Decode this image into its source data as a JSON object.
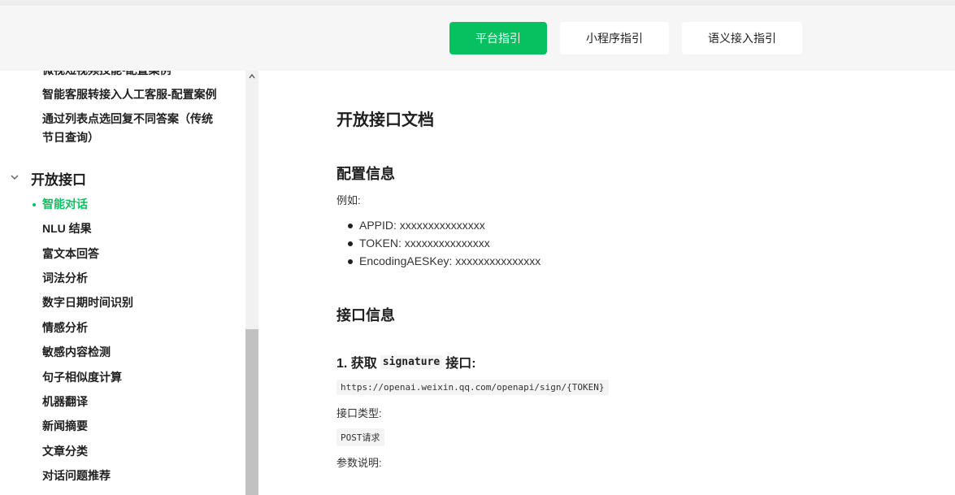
{
  "topnav": {
    "buttons": [
      {
        "label": "平台指引",
        "active": true
      },
      {
        "label": "小程序指引",
        "active": false
      },
      {
        "label": "语义接入指引",
        "active": false
      }
    ]
  },
  "sidebar": {
    "cut_item": "微视短视频技能-配置案例",
    "items_before": [
      "智能客服转接入人工客服-配置案例",
      "通过列表点选回复不同答案（传统节日查询）"
    ],
    "section_title": "开放接口",
    "items": [
      "智能对话",
      "NLU 结果",
      "富文本回答",
      "词法分析",
      "数字日期时间识别",
      "情感分析",
      "敏感内容检测",
      "句子相似度计算",
      "机器翻译",
      "新闻摘要",
      "文章分类",
      "对话问题推荐"
    ],
    "active_item": "智能对话"
  },
  "main": {
    "title": "开放接口文档",
    "config_title": "配置信息",
    "example_label": "例如:",
    "config_items": [
      "APPID: xxxxxxxxxxxxxxx",
      "TOKEN: xxxxxxxxxxxxxxx",
      "EncodingAESKey: xxxxxxxxxxxxxxx"
    ],
    "api_title": "接口信息",
    "step1_prefix": "1. 获取",
    "step1_code": "signature",
    "step1_suffix": "接口:",
    "url": "https://openai.weixin.qq.com/openapi/sign/{TOKEN}",
    "type_label": "接口类型:",
    "type_value": "POST请求",
    "params_label": "参数说明:"
  },
  "colors": {
    "accent": "#07c160",
    "topbar_bg": "#f6f6f6"
  }
}
